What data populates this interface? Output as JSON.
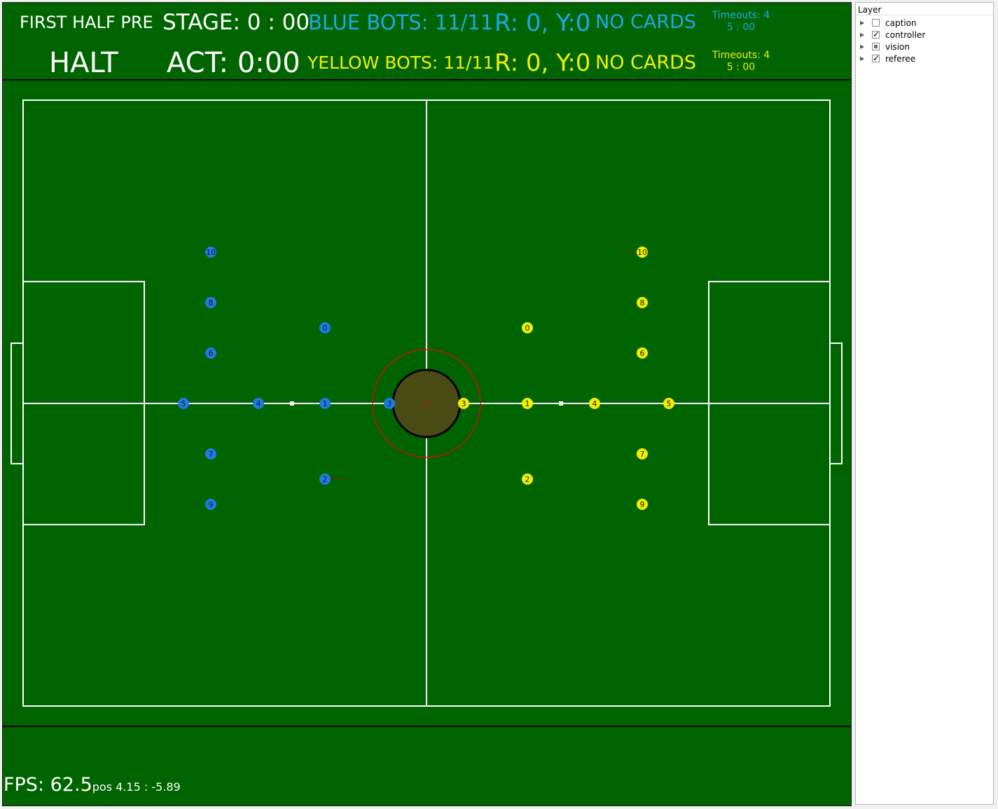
{
  "header": {
    "game_state": "FIRST HALF PRE",
    "stage_label": "STAGE: 0 : 00",
    "blue_bots": "BLUE BOTS: 11/11",
    "blue_cards_ry": "R: 0, Y:0",
    "blue_cards": "NO CARDS",
    "blue_timeouts": "Timeouts: 4",
    "blue_timeout_time": "5 : 00",
    "command": "HALT",
    "act_label": "ACT: 0:00",
    "yellow_bots": "YELLOW BOTS: 11/11",
    "yellow_cards_ry": "R: 0, Y:0",
    "yellow_cards": "NO CARDS",
    "yellow_timeouts": "Timeouts: 4",
    "yellow_timeout_time": "5 : 00"
  },
  "colors": {
    "field_green": "#006400",
    "blue_team": "#1e7be6",
    "yellow_team": "#f0f000",
    "blue_text": "#1ea8e8",
    "yellow_text": "#f0f000",
    "ring_red": "#cc1111",
    "center_fill": "#4a4a14"
  },
  "robots": {
    "blue": [
      {
        "id": "0"
      },
      {
        "id": "1"
      },
      {
        "id": "2"
      },
      {
        "id": "3"
      },
      {
        "id": "4"
      },
      {
        "id": "5"
      },
      {
        "id": "6"
      },
      {
        "id": "7"
      },
      {
        "id": "8"
      },
      {
        "id": "9"
      },
      {
        "id": "10"
      }
    ],
    "yellow": [
      {
        "id": "0"
      },
      {
        "id": "1"
      },
      {
        "id": "2"
      },
      {
        "id": "3"
      },
      {
        "id": "4"
      },
      {
        "id": "5"
      },
      {
        "id": "6"
      },
      {
        "id": "7"
      },
      {
        "id": "8"
      },
      {
        "id": "9"
      },
      {
        "id": "10"
      }
    ]
  },
  "status": {
    "fps": "FPS: 62.5",
    "pos": "pos 4.15 : -5.89"
  },
  "layer_panel": {
    "title": "Layer",
    "items": [
      {
        "label": "caption",
        "state": "unchecked"
      },
      {
        "label": "controller",
        "state": "checked"
      },
      {
        "label": "vision",
        "state": "partial"
      },
      {
        "label": "referee",
        "state": "checked"
      }
    ]
  }
}
